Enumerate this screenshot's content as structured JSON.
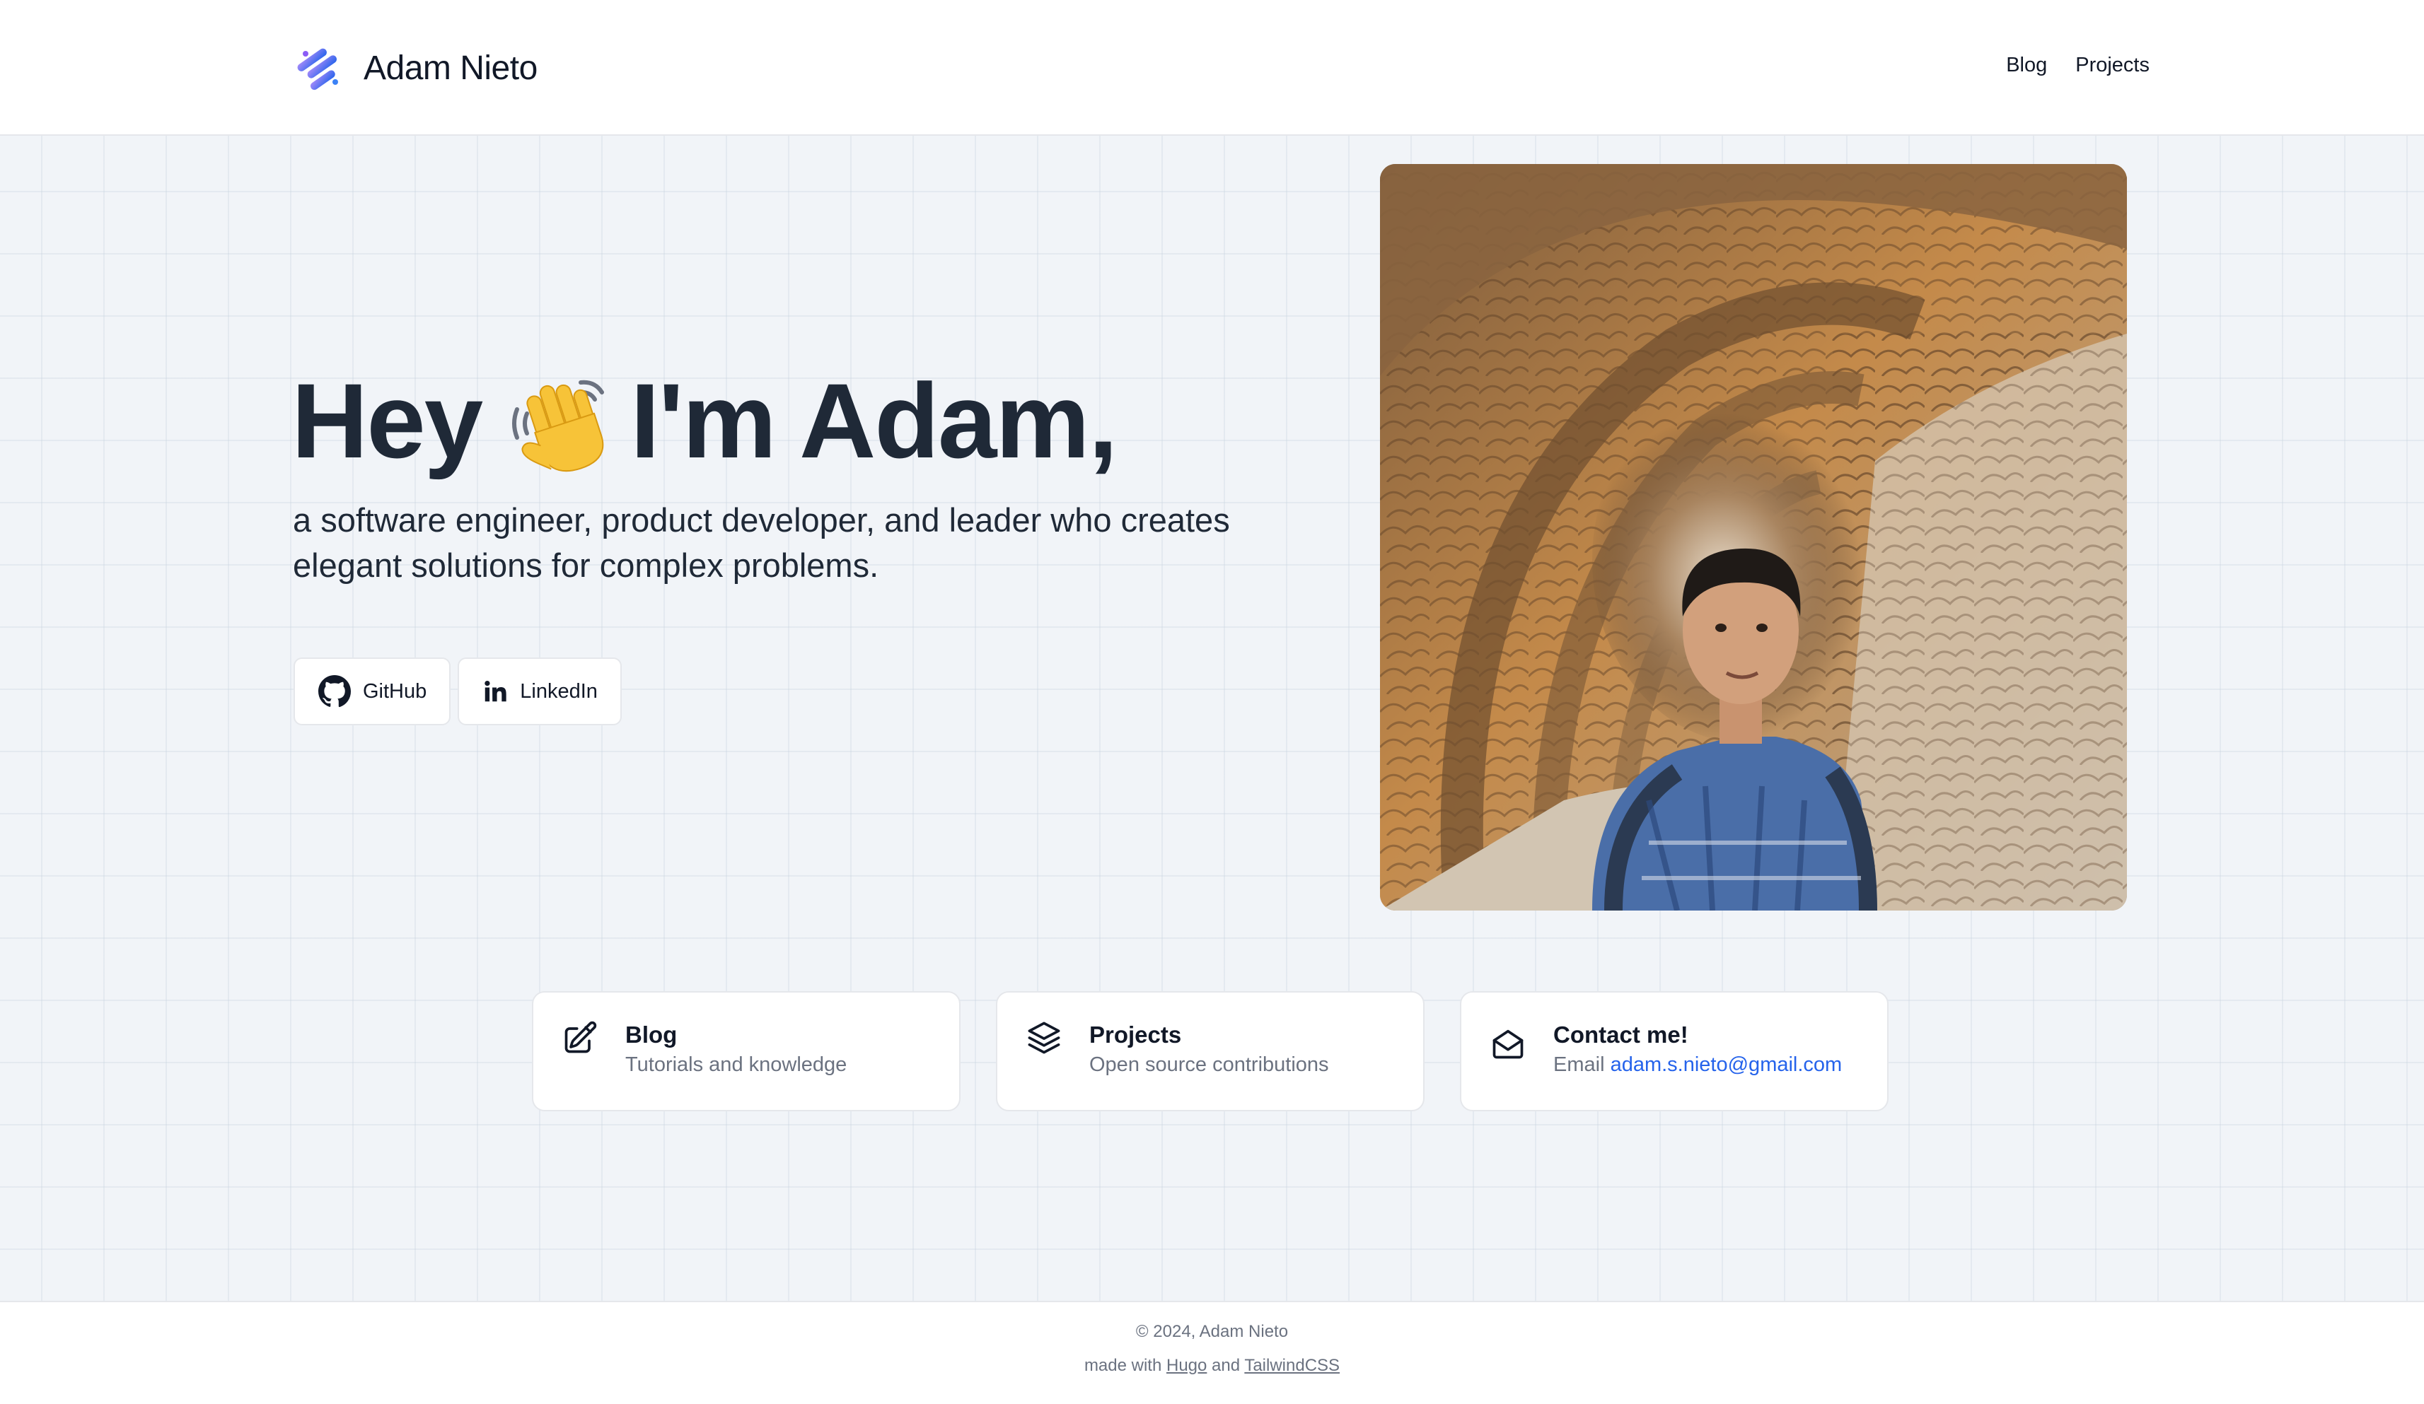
{
  "header": {
    "brand": "Adam Nieto",
    "nav": [
      {
        "label": "Blog"
      },
      {
        "label": "Projects"
      }
    ]
  },
  "hero": {
    "greeting_start": "Hey",
    "greeting_emoji": "waving-hand-icon",
    "greeting_end": "I'm Adam,",
    "subtitle": "a software engineer, product developer, and leader who creates elegant solutions for complex problems.",
    "buttons": [
      {
        "label": "GitHub",
        "icon": "github-icon"
      },
      {
        "label": "LinkedIn",
        "icon": "linkedin-icon"
      }
    ]
  },
  "cards": [
    {
      "title": "Blog",
      "description": "Tutorials and knowledge",
      "icon": "pencil-square-icon"
    },
    {
      "title": "Projects",
      "description": "Open source contributions",
      "icon": "layers-icon"
    },
    {
      "title": "Contact me!",
      "description_prefix": "Email",
      "email": "adam.s.nieto@gmail.com",
      "icon": "envelope-open-icon"
    }
  ],
  "footer": {
    "copyright": "© 2024, Adam Nieto",
    "made_with_prefix": "made with",
    "tool1": "Hugo",
    "joiner": "and",
    "tool2": "TailwindCSS"
  },
  "colors": {
    "accent_link": "#2563eb",
    "text_dark": "#1f2937",
    "logo_gradient": [
      "#8b5cf6",
      "#3b82f6"
    ]
  }
}
